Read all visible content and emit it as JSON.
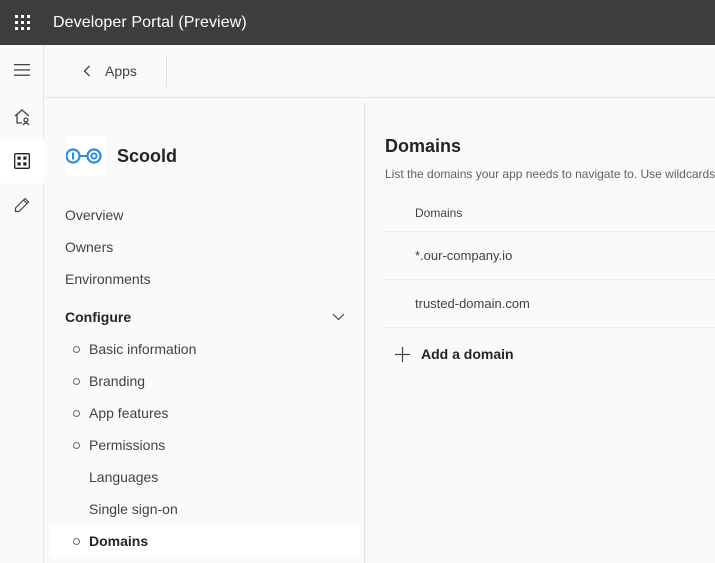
{
  "app": {
    "title": "Developer Portal (Preview)"
  },
  "icons": {
    "waffle": "app-launcher-icon",
    "hamburger": "hamburger-menu-icon",
    "home": "home-icon",
    "apps": "apps-grid-icon",
    "tools": "pencil-icon",
    "back": "chevron-left-icon",
    "chevron": "chevron-down-icon",
    "add": "plus-icon"
  },
  "header": {
    "back_label": "Apps"
  },
  "app_info": {
    "name": "Scoold"
  },
  "nav": {
    "items": [
      {
        "label": "Overview"
      },
      {
        "label": "Owners"
      },
      {
        "label": "Environments"
      }
    ],
    "configure": {
      "label": "Configure",
      "items": [
        {
          "label": "Basic information",
          "bullet": true
        },
        {
          "label": "Branding",
          "bullet": true
        },
        {
          "label": "App features",
          "bullet": true
        },
        {
          "label": "Permissions",
          "bullet": true
        },
        {
          "label": "Languages",
          "bullet": false
        },
        {
          "label": "Single sign-on",
          "bullet": false
        },
        {
          "label": "Domains",
          "bullet": true,
          "selected": true
        }
      ]
    }
  },
  "main": {
    "title": "Domains",
    "description": "List the domains your app needs to navigate to. Use wildcards",
    "table": {
      "column": "Domains",
      "rows": [
        {
          "domain": "*.our-company.io"
        },
        {
          "domain": "trusted-domain.com"
        }
      ]
    },
    "add_label": "Add a domain"
  },
  "colors": {
    "topbar": "#3d3d3d",
    "logo_blue": "#2b8fd6",
    "background": "#fafafa",
    "selected_background": "#ffffff"
  }
}
